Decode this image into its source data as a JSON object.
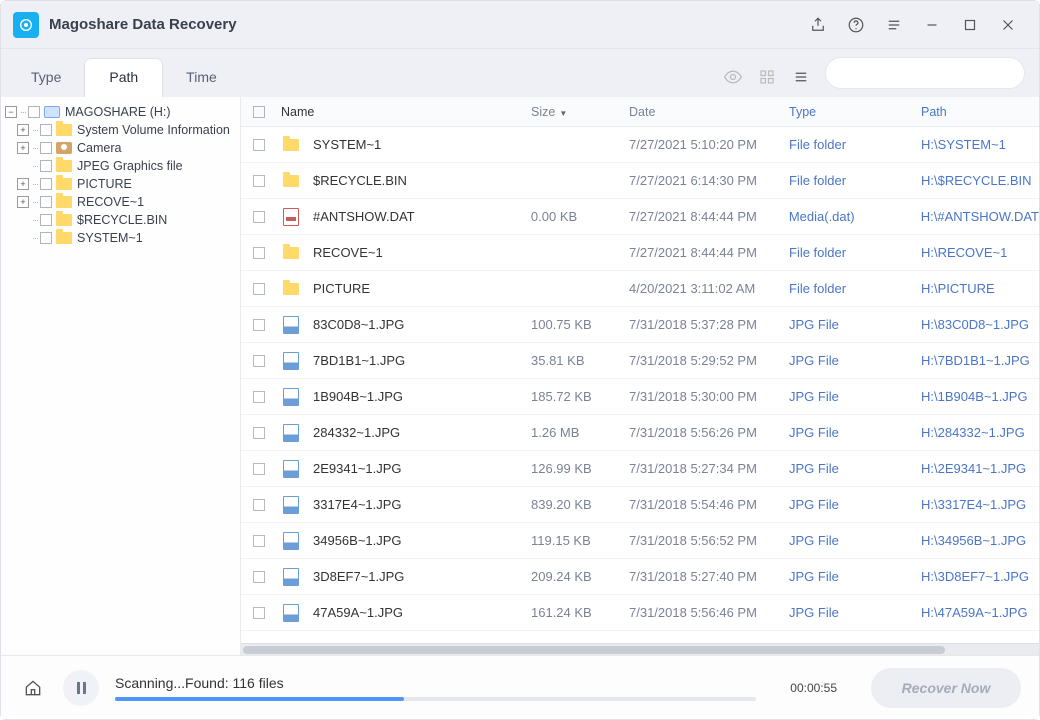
{
  "app": {
    "title": "Magoshare Data Recovery"
  },
  "tabs": {
    "type": "Type",
    "path": "Path",
    "time": "Time"
  },
  "search": {
    "placeholder": ""
  },
  "tree": {
    "root": "MAGOSHARE (H:)",
    "children": [
      "System Volume Information",
      "Camera",
      "JPEG Graphics file",
      "PICTURE",
      "RECOVE~1",
      "$RECYCLE.BIN",
      "SYSTEM~1"
    ]
  },
  "columns": {
    "name": "Name",
    "size": "Size",
    "date": "Date",
    "type": "Type",
    "path": "Path"
  },
  "files": [
    {
      "icon": "folder",
      "name": "SYSTEM~1",
      "size": "",
      "date": "7/27/2021 5:10:20 PM",
      "type": "File folder",
      "path": "H:\\SYSTEM~1"
    },
    {
      "icon": "folder",
      "name": "$RECYCLE.BIN",
      "size": "",
      "date": "7/27/2021 6:14:30 PM",
      "type": "File folder",
      "path": "H:\\$RECYCLE.BIN"
    },
    {
      "icon": "dat",
      "name": "#ANTSHOW.DAT",
      "size": "0.00 KB",
      "date": "7/27/2021 8:44:44 PM",
      "type": "Media(.dat)",
      "path": "H:\\#ANTSHOW.DAT"
    },
    {
      "icon": "folder",
      "name": "RECOVE~1",
      "size": "",
      "date": "7/27/2021 8:44:44 PM",
      "type": "File folder",
      "path": "H:\\RECOVE~1"
    },
    {
      "icon": "folder",
      "name": "PICTURE",
      "size": "",
      "date": "4/20/2021 3:11:02 AM",
      "type": "File folder",
      "path": "H:\\PICTURE"
    },
    {
      "icon": "jpg",
      "name": "83C0D8~1.JPG",
      "size": "100.75 KB",
      "date": "7/31/2018 5:37:28 PM",
      "type": "JPG File",
      "path": "H:\\83C0D8~1.JPG"
    },
    {
      "icon": "jpg",
      "name": "7BD1B1~1.JPG",
      "size": "35.81 KB",
      "date": "7/31/2018 5:29:52 PM",
      "type": "JPG File",
      "path": "H:\\7BD1B1~1.JPG"
    },
    {
      "icon": "jpg",
      "name": "1B904B~1.JPG",
      "size": "185.72 KB",
      "date": "7/31/2018 5:30:00 PM",
      "type": "JPG File",
      "path": "H:\\1B904B~1.JPG"
    },
    {
      "icon": "jpg",
      "name": "284332~1.JPG",
      "size": "1.26 MB",
      "date": "7/31/2018 5:56:26 PM",
      "type": "JPG File",
      "path": "H:\\284332~1.JPG"
    },
    {
      "icon": "jpg",
      "name": "2E9341~1.JPG",
      "size": "126.99 KB",
      "date": "7/31/2018 5:27:34 PM",
      "type": "JPG File",
      "path": "H:\\2E9341~1.JPG"
    },
    {
      "icon": "jpg",
      "name": "3317E4~1.JPG",
      "size": "839.20 KB",
      "date": "7/31/2018 5:54:46 PM",
      "type": "JPG File",
      "path": "H:\\3317E4~1.JPG"
    },
    {
      "icon": "jpg",
      "name": "34956B~1.JPG",
      "size": "119.15 KB",
      "date": "7/31/2018 5:56:52 PM",
      "type": "JPG File",
      "path": "H:\\34956B~1.JPG"
    },
    {
      "icon": "jpg",
      "name": "3D8EF7~1.JPG",
      "size": "209.24 KB",
      "date": "7/31/2018 5:27:40 PM",
      "type": "JPG File",
      "path": "H:\\3D8EF7~1.JPG"
    },
    {
      "icon": "jpg",
      "name": "47A59A~1.JPG",
      "size": "161.24 KB",
      "date": "7/31/2018 5:56:46 PM",
      "type": "JPG File",
      "path": "H:\\47A59A~1.JPG"
    }
  ],
  "status": {
    "text": "Scanning...Found: 116 files",
    "elapsed": "00:00:55",
    "recover": "Recover Now"
  }
}
